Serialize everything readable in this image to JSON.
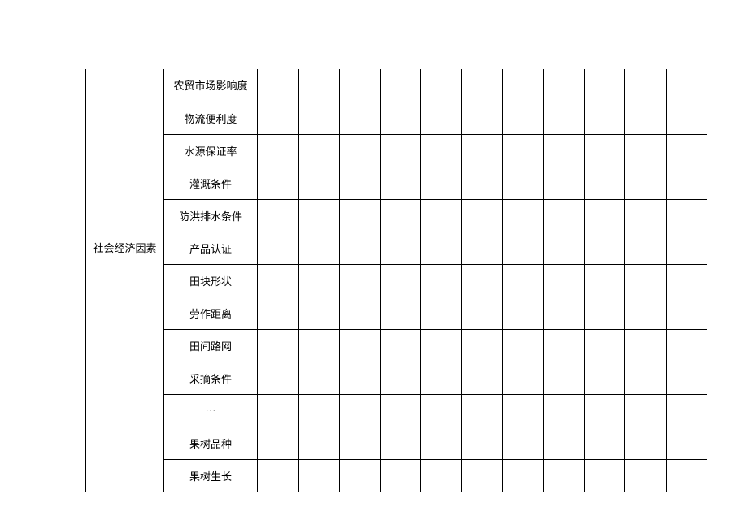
{
  "categories": {
    "col0": {
      "section1": "",
      "section2": ""
    },
    "col1": {
      "section1": "社会经济因素",
      "section2": ""
    }
  },
  "rows": [
    {
      "label": "农贸市场影响度"
    },
    {
      "label": "物流便利度"
    },
    {
      "label": "水源保证率"
    },
    {
      "label": "灌溉条件"
    },
    {
      "label": "防洪排水条件"
    },
    {
      "label": "产品认证"
    },
    {
      "label": "田块形状"
    },
    {
      "label": "劳作距离"
    },
    {
      "label": "田间路网"
    },
    {
      "label": "采摘条件"
    },
    {
      "label": "···"
    },
    {
      "label": "果树品种"
    },
    {
      "label": "果树生长"
    }
  ]
}
